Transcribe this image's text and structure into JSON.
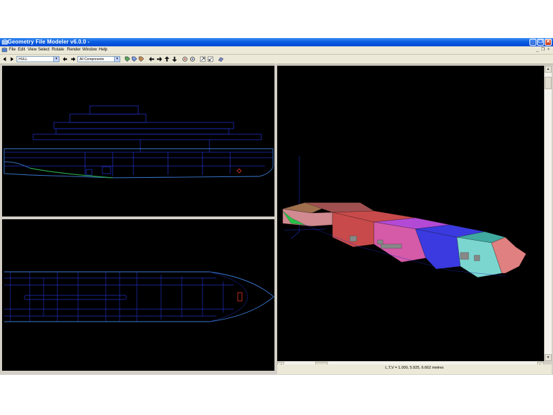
{
  "window": {
    "title": "Geometry File Modeler v6.0.0 -",
    "minimize_label": "_",
    "restore_label": "❐",
    "close_label": "✕"
  },
  "menu": {
    "items": [
      "File",
      "Edit",
      "View",
      "Select",
      "Rotate",
      "Render",
      "Window",
      "Help"
    ],
    "mdi_minimize": "_",
    "mdi_restore": "❐",
    "mdi_close": "×"
  },
  "toolbar": {
    "component_value": "HULL",
    "filter_value": "All Components",
    "dropdown_arrow": "▾"
  },
  "views": {
    "side": "side-elevation",
    "plan": "plan-view",
    "perspective": "3d-perspective"
  },
  "colors": {
    "wire": "#1f2fbf",
    "hull_line": "#3a7bd5",
    "green_line": "#28a048",
    "red_marker": "#d03020",
    "block_brown": "#a0704e",
    "block_red": "#c94a4a",
    "block_pink": "#d55aa8",
    "block_magenta": "#b34ad6",
    "block_blue": "#3a3ae0",
    "block_teal": "#40a9a0",
    "block_salmon": "#e08080"
  },
  "scroll": {
    "up_arrow": "▲",
    "down_arrow": "▼",
    "left_arrow": "◄",
    "right_arrow": "►"
  },
  "status": {
    "ltv": "L,T,V = 1.000, 5.925, 6.662 metres"
  }
}
